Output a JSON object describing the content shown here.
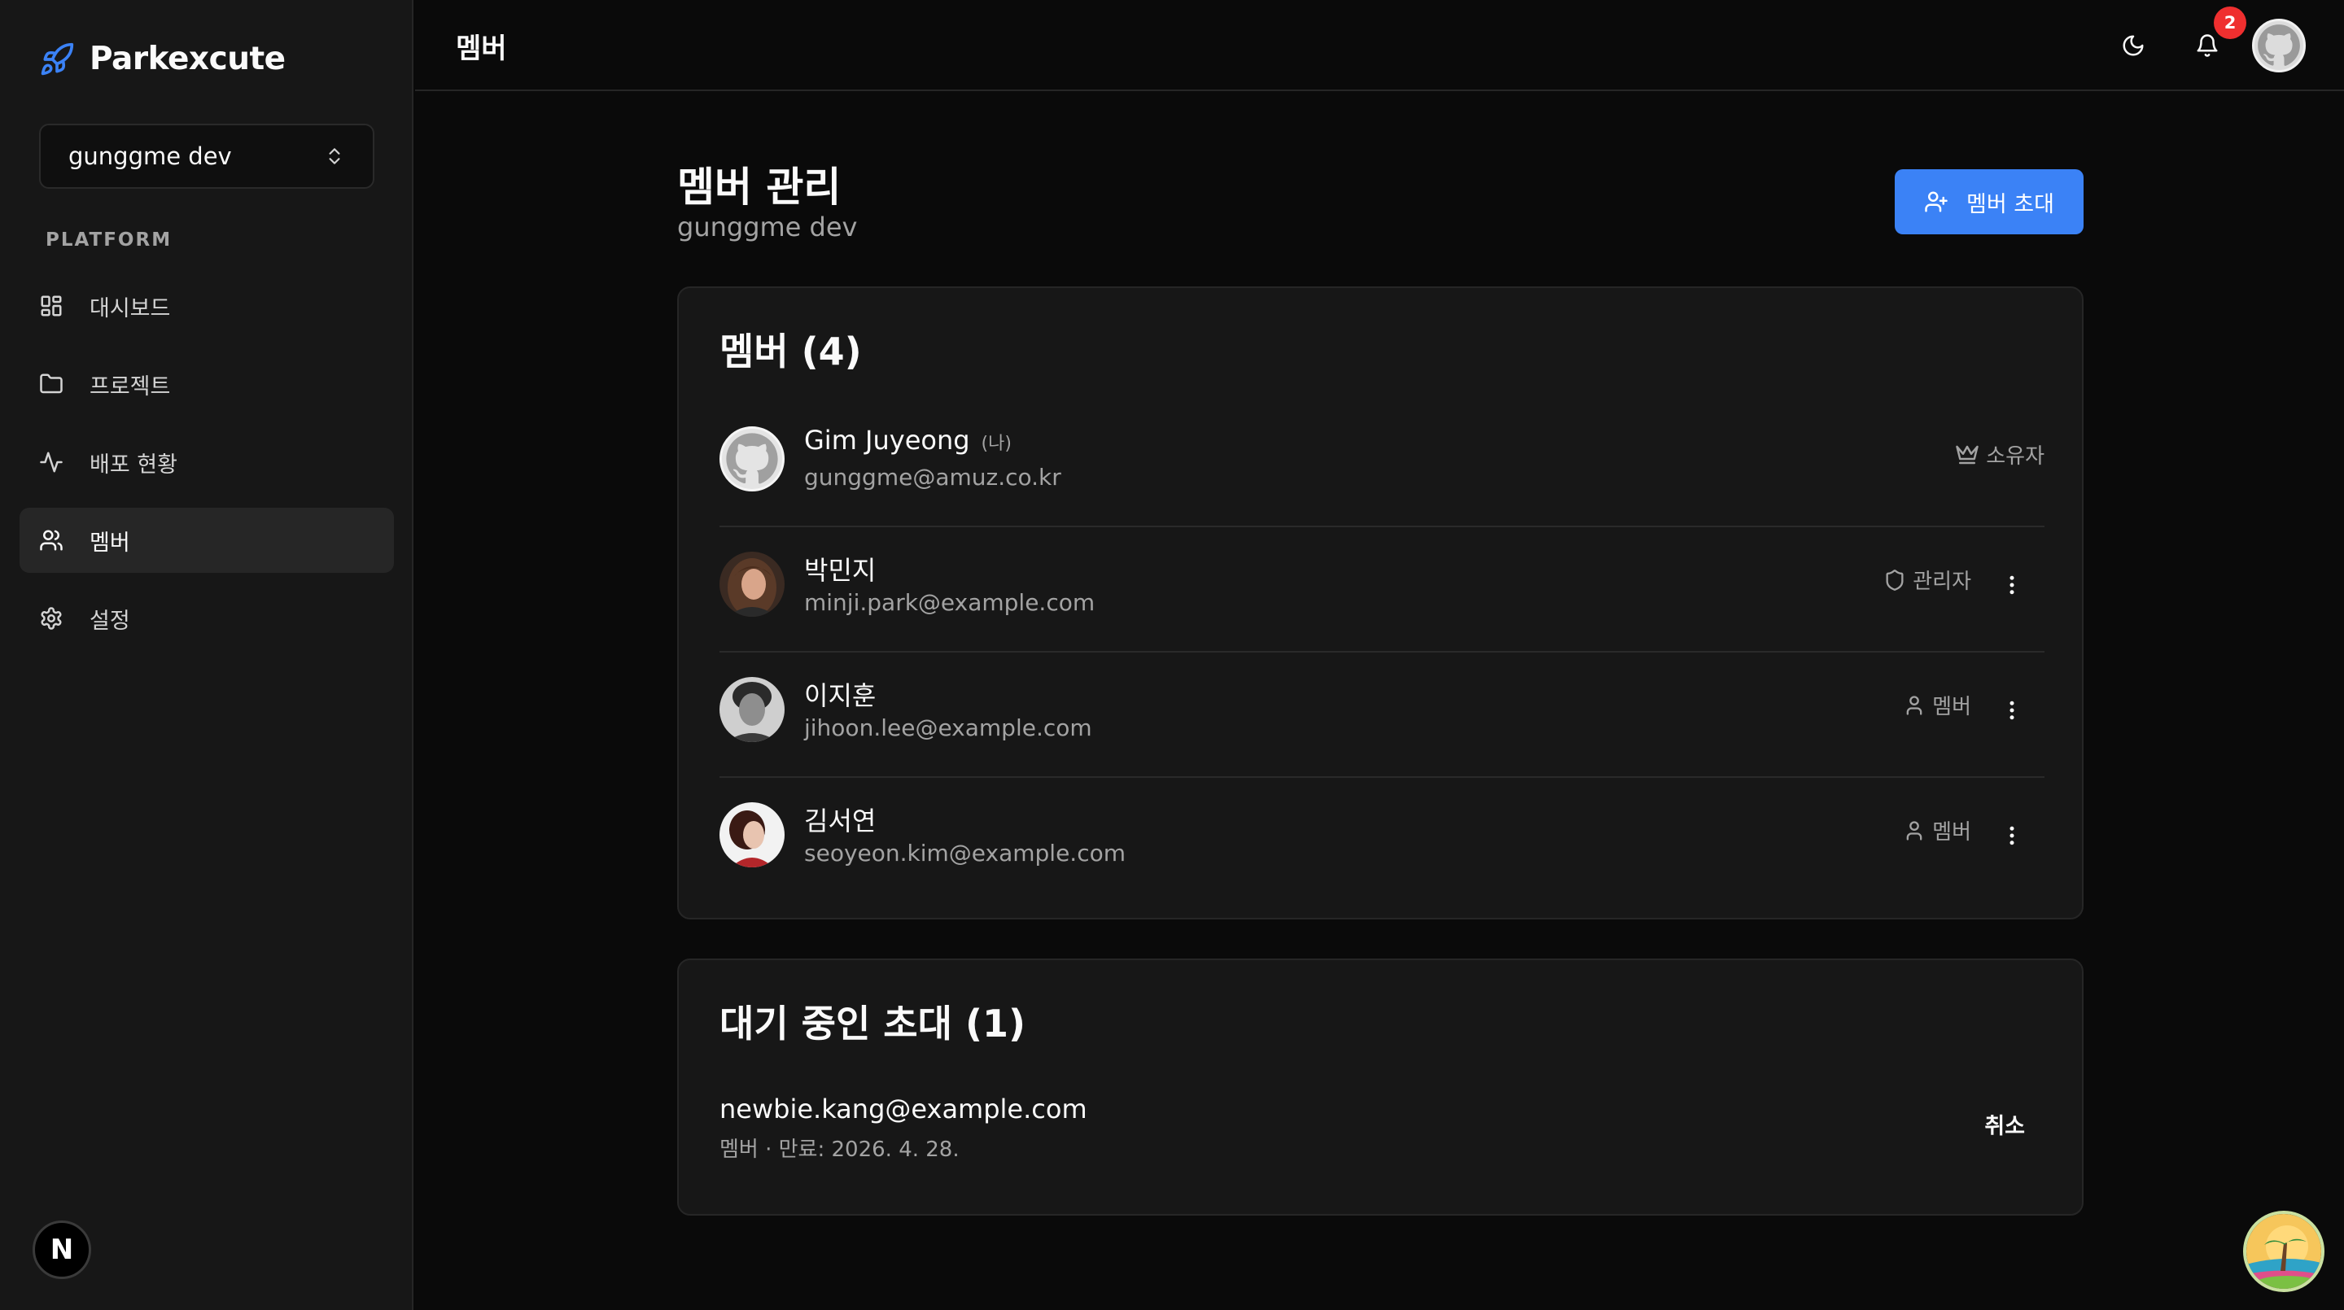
{
  "app": {
    "name": "Parkexcute",
    "accent": "#3b82f6"
  },
  "workspace": {
    "name": "gunggme dev"
  },
  "sidebar": {
    "group_label": "PLATFORM",
    "items": [
      {
        "label": "대시보드",
        "icon": "dashboard-icon",
        "active": false
      },
      {
        "label": "프로젝트",
        "icon": "folder-icon",
        "active": false
      },
      {
        "label": "배포 현황",
        "icon": "activity-icon",
        "active": false
      },
      {
        "label": "멤버",
        "icon": "users-icon",
        "active": true
      },
      {
        "label": "설정",
        "icon": "gear-icon",
        "active": false
      }
    ],
    "footer_badge": "N"
  },
  "header": {
    "title": "멤버",
    "notification_count": "2"
  },
  "page": {
    "title": "멤버 관리",
    "subtitle": "gunggme dev",
    "invite_button": "멤버 초대"
  },
  "members_card": {
    "title": "멤버 (4)",
    "members": [
      {
        "name": "Gim Juyeong",
        "me_tag": "(나)",
        "email": "gunggme@amuz.co.kr",
        "role": "소유자",
        "role_icon": "crown-icon",
        "avatar": "github-avatar"
      },
      {
        "name": "박민지",
        "me_tag": "",
        "email": "minji.park@example.com",
        "role": "관리자",
        "role_icon": "shield-icon",
        "avatar": "photo-avatar"
      },
      {
        "name": "이지훈",
        "me_tag": "",
        "email": "jihoon.lee@example.com",
        "role": "멤버",
        "role_icon": "user-icon",
        "avatar": "photo-avatar"
      },
      {
        "name": "김서연",
        "me_tag": "",
        "email": "seoyeon.kim@example.com",
        "role": "멤버",
        "role_icon": "user-icon",
        "avatar": "photo-avatar"
      }
    ]
  },
  "pending_card": {
    "title": "대기 중인 초대 (1)",
    "invites": [
      {
        "email": "newbie.kang@example.com",
        "meta": "멤버 · 만료: 2026. 4. 28.",
        "cancel_label": "취소"
      }
    ]
  }
}
